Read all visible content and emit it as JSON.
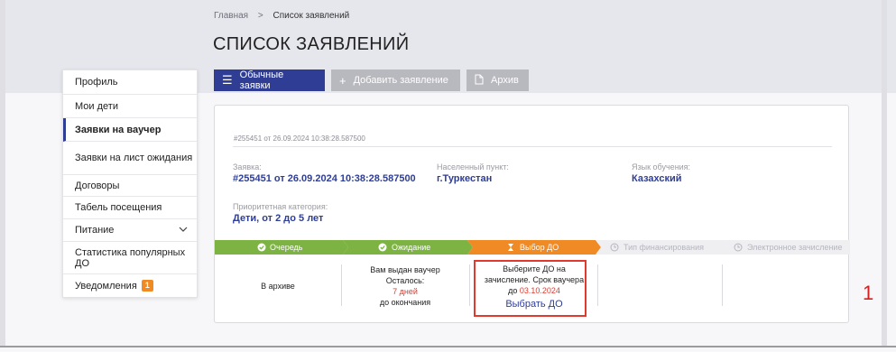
{
  "breadcrumb": {
    "home": "Главная",
    "separator": ">",
    "current": "Список заявлений"
  },
  "page_title": "СПИСОК ЗАЯВЛЕНИЙ",
  "tabs": [
    {
      "label": "Обычные заявки",
      "icon": "hamburger-icon",
      "active": true
    },
    {
      "label": "Добавить заявление",
      "icon": "plus-icon",
      "active": false
    },
    {
      "label": "Архив",
      "icon": "document-icon",
      "active": false
    }
  ],
  "sidebar": {
    "items": [
      {
        "label": "Профиль"
      },
      {
        "label": "Мои дети"
      },
      {
        "label": "Заявки на ваучер",
        "active": true
      },
      {
        "label": "Заявки на лист ожидания"
      },
      {
        "label": "Договоры"
      },
      {
        "label": "Табель посещения"
      },
      {
        "label": "Питание",
        "has_chevron": true
      },
      {
        "label": "Статистика популярных ДО"
      },
      {
        "label": "Уведомления",
        "badge": "1"
      }
    ]
  },
  "application": {
    "id_small": "#255451 от 26.09.2024 10:38:28.587500",
    "app_label": "Заявка:",
    "app_value": "#255451 от 26.09.2024 10:38:28.587500",
    "locality_label": "Населенный пункт:",
    "locality_value": "г.Туркестан",
    "language_label": "Язык обучения:",
    "language_value": "Казахский",
    "category_label": "Приоритетная категория:",
    "category_value": "Дети, от 2 до 5 лет"
  },
  "progress": {
    "colors": {
      "done": "#7cb342",
      "current": "#f08a24",
      "future": "#efeff2"
    },
    "steps": [
      {
        "label": "Очередь",
        "state": "done",
        "icon": "check-circle-icon"
      },
      {
        "label": "Ожидание",
        "state": "done",
        "icon": "check-circle-icon"
      },
      {
        "label": "Выбор ДО",
        "state": "current",
        "icon": "hourglass-icon"
      },
      {
        "label": "Тип финансирования",
        "state": "future",
        "icon": "clock-icon"
      },
      {
        "label": "Электронное зачисление",
        "state": "future",
        "icon": "clock-icon"
      }
    ]
  },
  "cells": {
    "archive": "В архиве",
    "voucher_line1": "Вам выдан ваучер",
    "voucher_line2": "Осталось:",
    "voucher_days": "7 дней",
    "voucher_line4": "до окончания",
    "select_line1": "Выберите ДО на",
    "select_line2": "зачисление. Срок ваучера",
    "select_line3_prefix": "до",
    "select_date": "03.10.2024",
    "select_link": "Выбрать ДО"
  },
  "annotation": "1",
  "colors": {
    "accent": "#2f3e94",
    "highlight": "#e03a2e",
    "badge": "#f08a24"
  }
}
